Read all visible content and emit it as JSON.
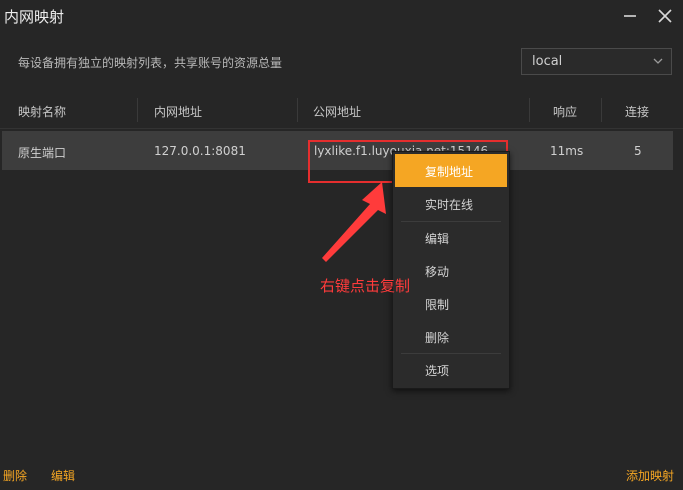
{
  "window": {
    "title": "内网映射",
    "minimize_icon": "minimize-icon",
    "close_icon": "close-icon"
  },
  "description": "每设备拥有独立的映射列表，共享账号的资源总量",
  "device_select": {
    "value": "local",
    "icon": "chevron-down-icon"
  },
  "table": {
    "columns": [
      "映射名称",
      "内网地址",
      "公网地址",
      "响应",
      "连接"
    ],
    "rows": [
      {
        "name": "原生端口",
        "local": "127.0.0.1:8081",
        "public": "lyxlike.f1.luyouxia.net:15146",
        "latency": "11ms",
        "connections": "5"
      }
    ]
  },
  "context_menu": {
    "items": [
      "复制地址",
      "实时在线",
      "编辑",
      "移动",
      "限制",
      "删除",
      "选项"
    ],
    "active_index": 0,
    "active_color": "#f5a623"
  },
  "annotation": {
    "text": "右键点击复制",
    "color": "#ff3b3b"
  },
  "footer": {
    "delete_label": "删除",
    "edit_label": "编辑",
    "add_label": "添加映射"
  },
  "colors": {
    "accent": "#f5a623",
    "background": "#262626",
    "row_selected": "#3d3d3d",
    "highlight": "#e52e2e"
  }
}
